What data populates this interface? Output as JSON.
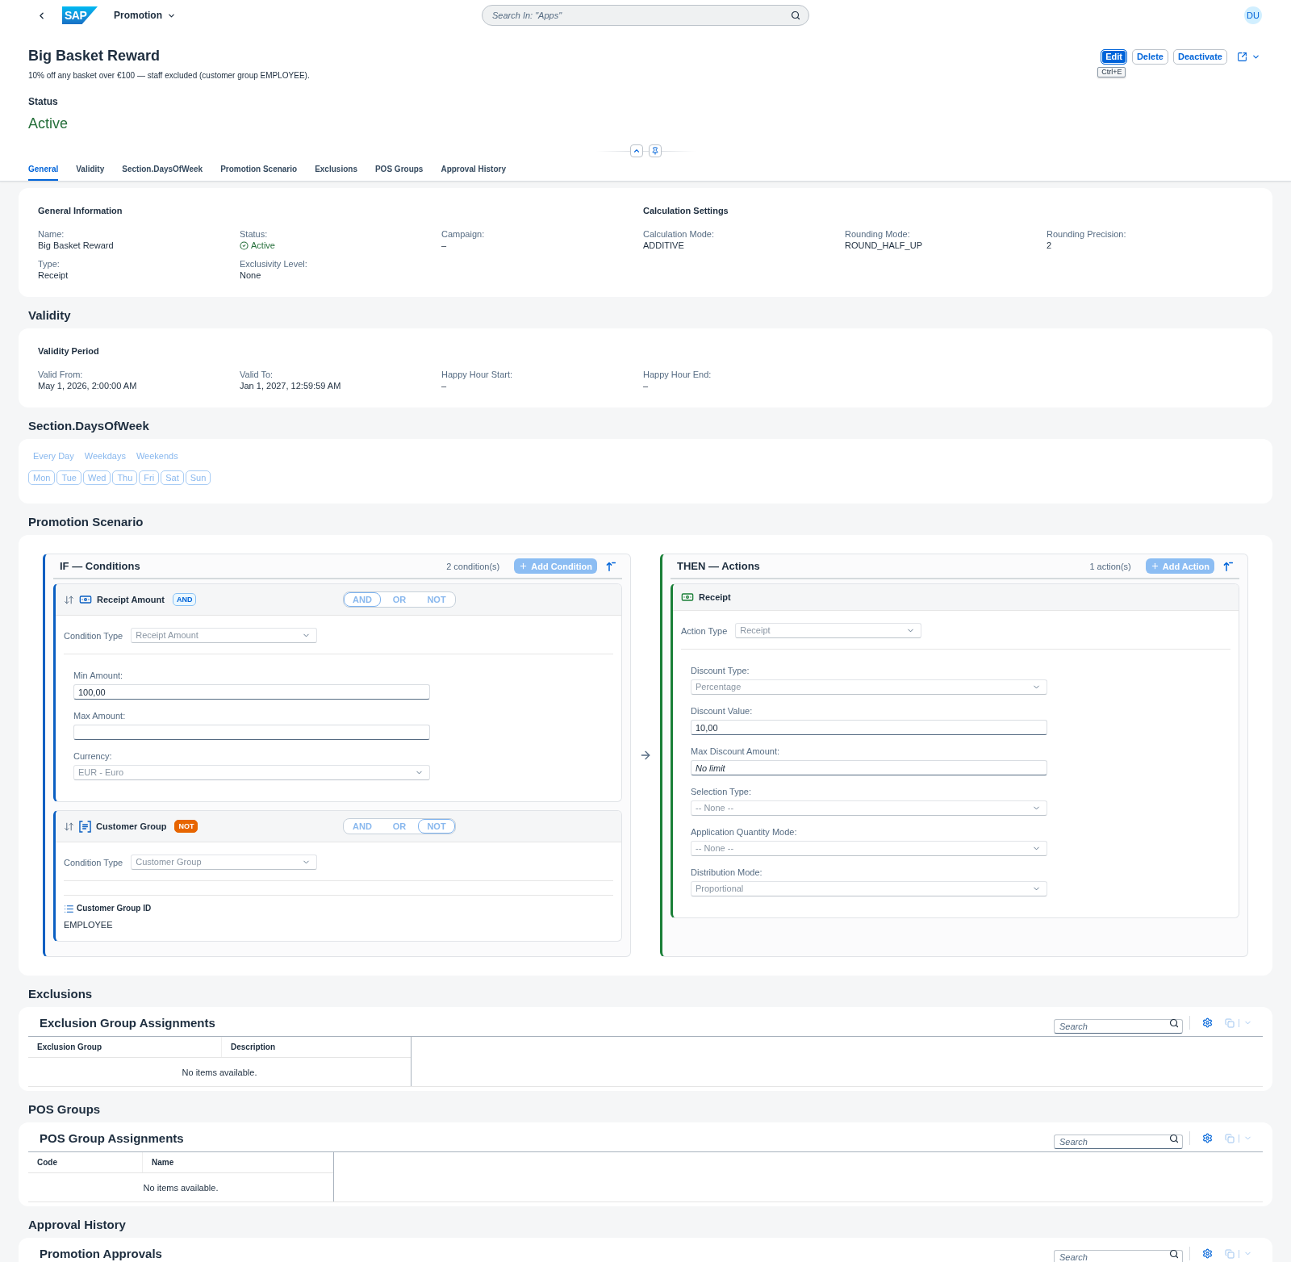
{
  "shell": {
    "logo": "SAP",
    "app_title": "Promotion",
    "search": {
      "placeholder": "Search In: \"Apps\""
    },
    "avatar": "DU"
  },
  "header": {
    "title": "Big Basket Reward",
    "subtitle": "10% off any basket over €100 — staff excluded (customer group EMPLOYEE).",
    "actions": [
      {
        "label": "Edit",
        "kind": "emphasized"
      },
      {
        "label": "Delete",
        "kind": "default"
      },
      {
        "label": "Deactivate",
        "kind": "default"
      }
    ],
    "shortcut_hint": "Ctrl+E",
    "status_label": "Status",
    "status_value": "Active"
  },
  "tabs": [
    {
      "label": "General",
      "selected": true
    },
    {
      "label": "Validity",
      "selected": false
    },
    {
      "label": "Section.DaysOfWeek",
      "selected": false
    },
    {
      "label": "Promotion Scenario",
      "selected": false
    },
    {
      "label": "Exclusions",
      "selected": false
    },
    {
      "label": "POS Groups",
      "selected": false
    },
    {
      "label": "Approval History",
      "selected": false
    }
  ],
  "sections": [
    {
      "kind": "fields",
      "groups": [
        {
          "title": "General Information",
          "fields": [
            {
              "kind": "text",
              "label": "Name:",
              "value": "Big Basket Reward"
            },
            {
              "kind": "status",
              "label": "Status:",
              "value": "Active"
            },
            {
              "kind": "text",
              "label": "Campaign:",
              "value": "–"
            },
            {
              "kind": "text",
              "label": "Type:",
              "value": "Receipt"
            },
            {
              "kind": "text",
              "label": "Exclusivity Level:",
              "value": "None"
            }
          ]
        },
        {
          "title": "Calculation Settings",
          "fields": [
            {
              "kind": "text",
              "label": "Calculation Mode:",
              "value": "ADDITIVE"
            },
            {
              "kind": "text",
              "label": "Rounding Mode:",
              "value": "ROUND_HALF_UP"
            },
            {
              "kind": "text",
              "label": "Rounding Precision:",
              "value": "2"
            }
          ]
        }
      ]
    },
    {
      "kind": "fields",
      "heading": "Validity",
      "groups": [
        {
          "title": "Validity Period",
          "fields": [
            {
              "kind": "text",
              "label": "Valid From:",
              "value": "May 1, 2026, 2:00:00 AM"
            },
            {
              "kind": "text",
              "label": "Valid To:",
              "value": "Jan 1, 2027, 12:59:59 AM"
            },
            {
              "kind": "text",
              "label": "Happy Hour Start:",
              "value": "–"
            },
            {
              "kind": "text",
              "label": "Happy Hour End:",
              "value": "–"
            }
          ]
        }
      ]
    },
    {
      "kind": "days",
      "heading": "Section.DaysOfWeek",
      "presets": [
        "Every Day",
        "Weekdays",
        "Weekends"
      ],
      "days": [
        {
          "label": "Mon",
          "selected": false
        },
        {
          "label": "Tue",
          "selected": false
        },
        {
          "label": "Wed",
          "selected": false
        },
        {
          "label": "Thu",
          "selected": false
        },
        {
          "label": "Fri",
          "selected": false
        },
        {
          "label": "Sat",
          "selected": false
        },
        {
          "label": "Sun",
          "selected": false
        }
      ]
    },
    {
      "kind": "scenario",
      "heading": "Promotion Scenario",
      "conditions": {
        "title": "IF — Conditions",
        "count": "2 condition(s)",
        "add_label": "Add Condition",
        "items": [
          {
            "kind": "amount",
            "title": "Receipt Amount",
            "badge": {
              "kind": "and",
              "label": "AND"
            },
            "operators": [
              {
                "label": "AND",
                "selected": true
              },
              {
                "label": "OR",
                "selected": false
              },
              {
                "label": "NOT",
                "selected": false
              }
            ],
            "type": {
              "label": "Condition Type",
              "value": "Receipt Amount",
              "disabled": true
            },
            "fields": [
              {
                "kind": "input",
                "label": "Min Amount:",
                "value": "100,00"
              },
              {
                "kind": "input",
                "label": "Max Amount:"
              },
              {
                "kind": "select",
                "label": "Currency:",
                "value": "EUR - Euro",
                "disabled": true
              }
            ]
          },
          {
            "kind": "group",
            "title": "Customer Group",
            "badge": {
              "kind": "not",
              "label": "NOT"
            },
            "operators": [
              {
                "label": "AND",
                "selected": false
              },
              {
                "label": "OR",
                "selected": false
              },
              {
                "label": "NOT",
                "selected": true
              }
            ],
            "type": {
              "label": "Condition Type",
              "value": "Customer Group",
              "disabled": true
            },
            "detail": {
              "label": "Customer Group ID",
              "value": "EMPLOYEE"
            }
          }
        ]
      },
      "actions": {
        "title": "THEN — Actions",
        "count": "1 action(s)",
        "add_label": "Add Action",
        "items": [
          {
            "kind": "receipt",
            "title": "Receipt",
            "type": {
              "label": "Action Type",
              "value": "Receipt",
              "disabled": true
            },
            "fields": [
              {
                "kind": "select",
                "label": "Discount Type:",
                "value": "Percentage",
                "disabled": true
              },
              {
                "kind": "input",
                "label": "Discount Value:",
                "value": "10,00"
              },
              {
                "kind": "input",
                "label": "Max Discount Amount:",
                "placeholder": "No limit"
              },
              {
                "kind": "select",
                "label": "Selection Type:",
                "value": "-- None --",
                "disabled": true
              },
              {
                "kind": "select",
                "label": "Application Quantity Mode:",
                "value": "-- None --",
                "disabled": true
              },
              {
                "kind": "select",
                "label": "Distribution Mode:",
                "value": "Proportional",
                "disabled": true
              }
            ]
          }
        ]
      }
    },
    {
      "kind": "table",
      "heading": "Exclusions",
      "title": "Exclusion Group Assignments",
      "search_placeholder": "Search",
      "columns": [
        "Exclusion Group",
        "Description"
      ],
      "empty_text": "No items available."
    },
    {
      "kind": "table",
      "heading": "POS Groups",
      "title": "POS Group Assignments",
      "search_placeholder": "Search",
      "columns": [
        "Code",
        "Name"
      ],
      "empty_text": "No items available."
    },
    {
      "kind": "table",
      "heading": "Approval History",
      "title": "Promotion Approvals",
      "search_placeholder": "Search"
    }
  ]
}
